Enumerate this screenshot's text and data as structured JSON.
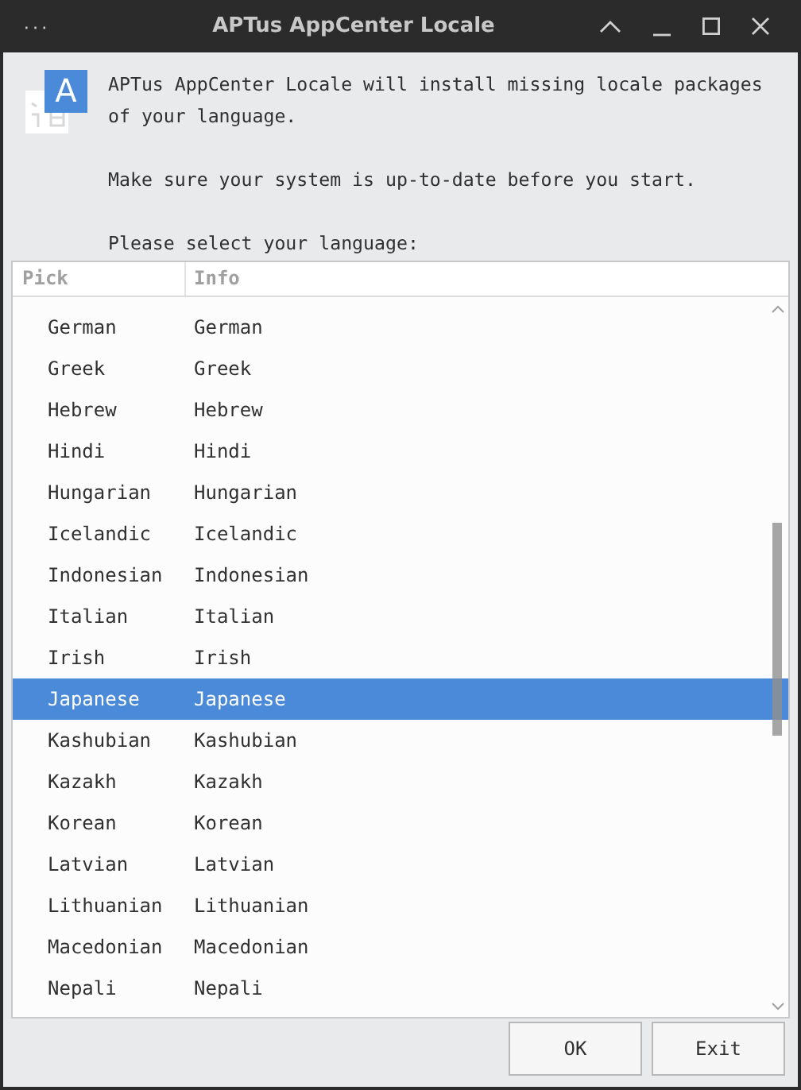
{
  "window": {
    "title": "APTus AppCenter Locale",
    "menu_glyph": "···"
  },
  "app_icon": {
    "front_glyph": "A"
  },
  "intro": [
    "APTus AppCenter Locale will install missing locale packages of your language.",
    "Make sure your system is up-to-date before you start.",
    "Please select your language:"
  ],
  "table": {
    "columns": [
      "Pick",
      "Info"
    ],
    "rows": [
      {
        "pick": "German",
        "info": "German",
        "selected": false
      },
      {
        "pick": "Greek",
        "info": "Greek",
        "selected": false
      },
      {
        "pick": "Hebrew",
        "info": "Hebrew",
        "selected": false
      },
      {
        "pick": "Hindi",
        "info": "Hindi",
        "selected": false
      },
      {
        "pick": "Hungarian",
        "info": "Hungarian",
        "selected": false
      },
      {
        "pick": "Icelandic",
        "info": "Icelandic",
        "selected": false
      },
      {
        "pick": "Indonesian",
        "info": "Indonesian",
        "selected": false
      },
      {
        "pick": "Italian",
        "info": "Italian",
        "selected": false
      },
      {
        "pick": "Irish",
        "info": "Irish",
        "selected": false
      },
      {
        "pick": "Japanese",
        "info": "Japanese",
        "selected": true
      },
      {
        "pick": "Kashubian",
        "info": "Kashubian",
        "selected": false
      },
      {
        "pick": "Kazakh",
        "info": "Kazakh",
        "selected": false
      },
      {
        "pick": "Korean",
        "info": "Korean",
        "selected": false
      },
      {
        "pick": "Latvian",
        "info": "Latvian",
        "selected": false
      },
      {
        "pick": "Lithuanian",
        "info": "Lithuanian",
        "selected": false
      },
      {
        "pick": "Macedonian",
        "info": "Macedonian",
        "selected": false
      },
      {
        "pick": "Nepali",
        "info": "Nepali",
        "selected": false
      }
    ]
  },
  "buttons": [
    "OK",
    "Exit"
  ]
}
